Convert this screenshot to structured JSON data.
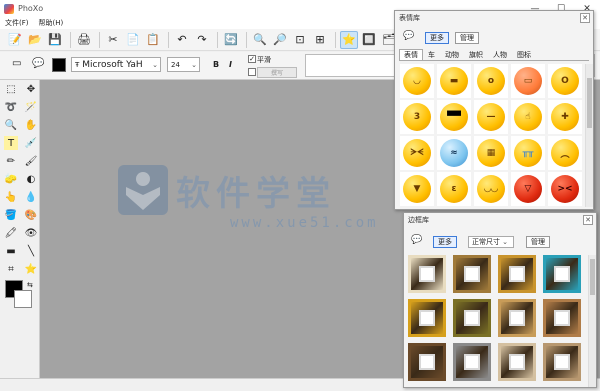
{
  "app": {
    "title": "PhoXo"
  },
  "window_controls": {
    "minimize": "—",
    "maximize": "☐",
    "close": "✕"
  },
  "menu": [
    {
      "label": "文件(F)"
    },
    {
      "label": "帮助(H)"
    }
  ],
  "text_toolbar": {
    "font_name": "Microsoft YaH",
    "font_size": "24",
    "bold": "B",
    "italic": "I",
    "smooth_label": "平滑",
    "smooth_checked": "✓",
    "blank_button": "撰写"
  },
  "canvas": {
    "watermark_text": "软件学堂",
    "watermark_url": "www.xue51.com"
  },
  "emoticon_panel": {
    "title": "表情库",
    "more_button": "更多",
    "manage_button": "管理",
    "tabs": [
      {
        "label": "表情",
        "active": true
      },
      {
        "label": "车",
        "active": false
      },
      {
        "label": "动物",
        "active": false
      },
      {
        "label": "旗帜",
        "active": false
      },
      {
        "label": "人物",
        "active": false
      },
      {
        "label": "图标",
        "active": false
      }
    ],
    "emoticons": [
      {
        "name": "smile-face"
      },
      {
        "name": "grin-face"
      },
      {
        "name": "surprised-face"
      },
      {
        "name": "eraser-face"
      },
      {
        "name": "scared-face"
      },
      {
        "name": "kiss-face"
      },
      {
        "name": "sunglasses-face"
      },
      {
        "name": "sleepy-face"
      },
      {
        "name": "shh-face"
      },
      {
        "name": "bandaid-face"
      },
      {
        "name": "angry-face"
      },
      {
        "name": "sweat-face"
      },
      {
        "name": "gritting-face"
      },
      {
        "name": "crying-face"
      },
      {
        "name": "sad-face"
      },
      {
        "name": "shouting-face"
      },
      {
        "name": "pouting-face"
      },
      {
        "name": "laughing-face"
      },
      {
        "name": "devil-face"
      },
      {
        "name": "wince-face"
      }
    ]
  },
  "frame_panel": {
    "title": "边框库",
    "more_button": "更多",
    "size_select": "正常尺寸",
    "manage_button": "管理",
    "frames": [
      {
        "color": "#e8dcc0"
      },
      {
        "color": "#a07a3a"
      },
      {
        "color": "#c9942c"
      },
      {
        "color": "#2aa0b8"
      },
      {
        "color": "#d6a01c"
      },
      {
        "color": "#7a7026"
      },
      {
        "color": "#c89c58"
      },
      {
        "color": "#b07c48"
      },
      {
        "color": "#6a4a2a"
      },
      {
        "color": "#8a8a8a"
      },
      {
        "color": "#d4c0a0"
      },
      {
        "color": "#b89870"
      }
    ]
  }
}
